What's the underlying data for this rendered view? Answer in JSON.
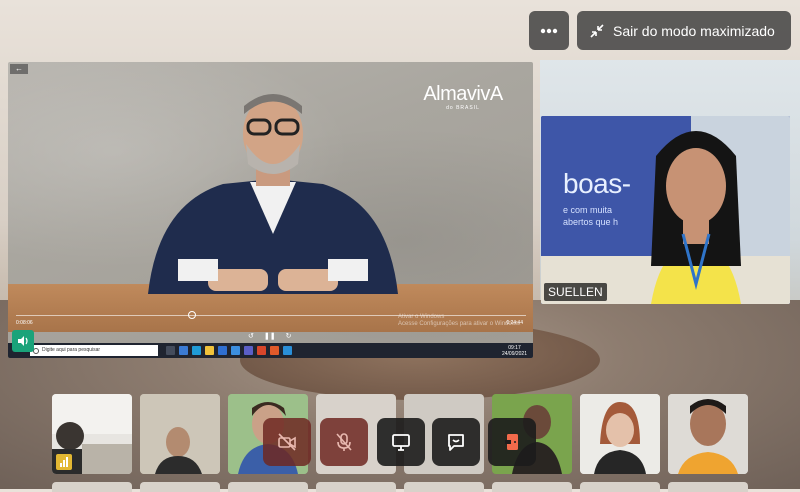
{
  "top_bar": {
    "more_label": "more-options",
    "exit_label": "Sair do modo maximizado"
  },
  "shared_screen": {
    "logo_main": "AlmavivA",
    "logo_sub": "do BRASIL",
    "time_left": "0:08:06",
    "time_right": "0:24:44",
    "watermark_line1": "Ativar o Windows",
    "watermark_line2": "Acesse Configurações para ativar o Windows.",
    "taskbar_search_placeholder": "Digite aqui para pesquisar",
    "tray_time": "09:17",
    "tray_date": "24/09/2021"
  },
  "side_video": {
    "banner_title": "boas-",
    "banner_sub_1": "e com muita",
    "banner_sub_2": "abertos que h",
    "participant_name": "SUELLEN"
  },
  "controls": {
    "camera": "camera-off",
    "mic": "mic-off",
    "share": "screen-share",
    "reactions": "reactions",
    "leave": "leave"
  },
  "colors": {
    "control_red": "#6e2822",
    "control_dark": "#1c1c1c",
    "audio_green": "#1aa37a",
    "leave_orange": "#f26a4b"
  }
}
